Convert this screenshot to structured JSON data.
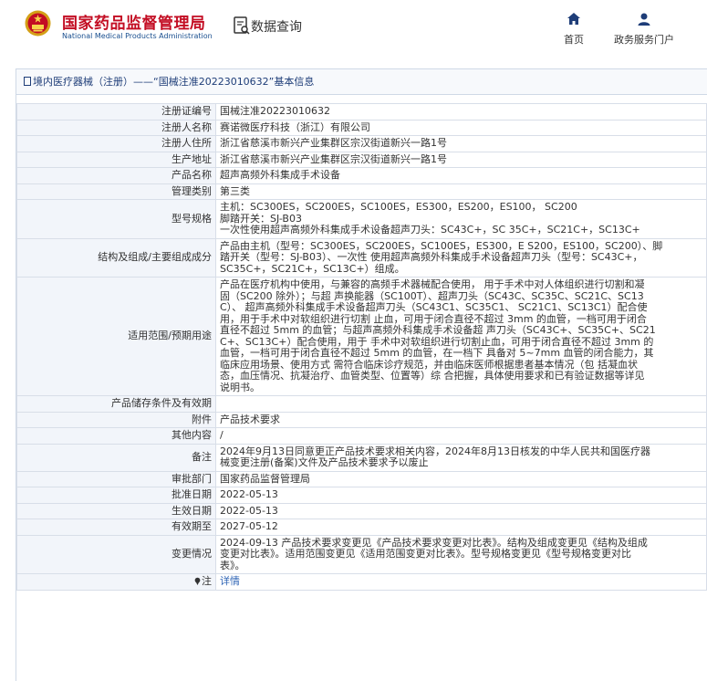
{
  "header": {
    "site_name_cn": "国家药品监督管理局",
    "site_name_en": "National Medical Products Administration",
    "data_query": "数据查询",
    "nav": {
      "home": "首页",
      "portal": "政务服务门户"
    }
  },
  "page": {
    "title": "境内医疗器械（注册）——“国械注准20223010632”基本信息"
  },
  "rows": [
    {
      "key": "注册证编号",
      "lines": [
        "国械注准20223010632"
      ]
    },
    {
      "key": "注册人名称",
      "lines": [
        "赛诺微医疗科技（浙江）有限公司"
      ]
    },
    {
      "key": "注册人住所",
      "lines": [
        "浙江省慈溪市新兴产业集群区宗汉街道新兴一路1号"
      ]
    },
    {
      "key": "生产地址",
      "lines": [
        "浙江省慈溪市新兴产业集群区宗汉街道新兴一路1号"
      ]
    },
    {
      "key": "产品名称",
      "lines": [
        "超声高频外科集成手术设备"
      ]
    },
    {
      "key": "管理类别",
      "lines": [
        "第三类"
      ]
    },
    {
      "key": "型号规格",
      "lines": [
        "主机：SC300ES，SC200ES，SC100ES，ES300，ES200，ES100， SC200",
        "脚踏开关：SJ-B03",
        "一次性使用超声高频外科集成手术设备超声刀头：SC43C+，SC 35C+，SC21C+，SC13C+"
      ]
    },
    {
      "key": "结构及组成/主要组成成分",
      "lines": [
        "产品由主机（型号：SC300ES，SC200ES，SC100ES，ES300，E S200，ES100，SC200）、脚",
        "踏开关（型号：SJ-B03）、一次性 使用超声高频外科集成手术设备超声刀头（型号：SC43C+，",
        "SC35C+，SC21C+，SC13C+）组成。"
      ]
    },
    {
      "key": "适用范围/预期用途",
      "lines": [
        "产品在医疗机构中使用，与兼容的高频手术器械配合使用， 用于手术中对人体组织进行切割和凝",
        "固（SC200 除外）；与超 声换能器（SC100T）、超声刀头（SC43C、SC35C、SC21C、SC13",
        "C）、 超声高频外科集成手术设备超声刀头（SC43C1、SC35C1、 SC21C1、SC13C1）配合使",
        "用，用于手术中对软组织进行切割 止血，可用于闭合直径不超过 3mm 的血管，一档可用于闭合",
        "直径不超过 5mm 的血管；与超声高频外科集成手术设备超 声刀头（SC43C+、SC35C+、SC21",
        "C+、SC13C+）配合使用，用于 手术中对软组织进行切割止血，可用于闭合直径不超过 3mm 的",
        "血管，一档可用于闭合直径不超过 5mm 的血管，在一档下 具备对 5~7mm 血管的闭合能力，其",
        "临床应用场景、使用方式 需符合临床诊疗规范，并由临床医师根据患者基本情况（包 括凝血状",
        "态，血压情况、抗凝治疗、血管类型、位置等）综 合把握，具体使用要求和已有验证数据等详见",
        "说明书。"
      ]
    },
    {
      "key": "产品储存条件及有效期",
      "lines": [
        ""
      ]
    },
    {
      "key": "附件",
      "lines": [
        "产品技术要求"
      ]
    },
    {
      "key": "其他内容",
      "lines": [
        "/"
      ]
    },
    {
      "key": "备注",
      "lines": [
        "2024年9月13日同意更正产品技术要求相关内容，2024年8月13日核发的中华人民共和国医疗器",
        "械变更注册(备案)文件及产品技术要求予以废止"
      ]
    },
    {
      "key": "审批部门",
      "lines": [
        "国家药品监督管理局"
      ]
    },
    {
      "key": "批准日期",
      "lines": [
        "2022-05-13"
      ]
    },
    {
      "key": "生效日期",
      "lines": [
        "2022-05-13"
      ]
    },
    {
      "key": "有效期至",
      "lines": [
        "2027-05-12"
      ]
    },
    {
      "key": "变更情况",
      "lines": [
        "2024-09-13 产品技术要求变更见《产品技术要求变更对比表》。结构及组成变更见《结构及组成",
        "变更对比表》。适用范围变更见《适用范围变更对比表》。型号规格变更见《型号规格变更对比",
        "表》。"
      ]
    }
  ],
  "note_row": {
    "key": "注",
    "link": "详情"
  },
  "colors": {
    "brand_red": "#c30d23",
    "nav_blue": "#1e3d78",
    "link_blue": "#2e64b5"
  }
}
